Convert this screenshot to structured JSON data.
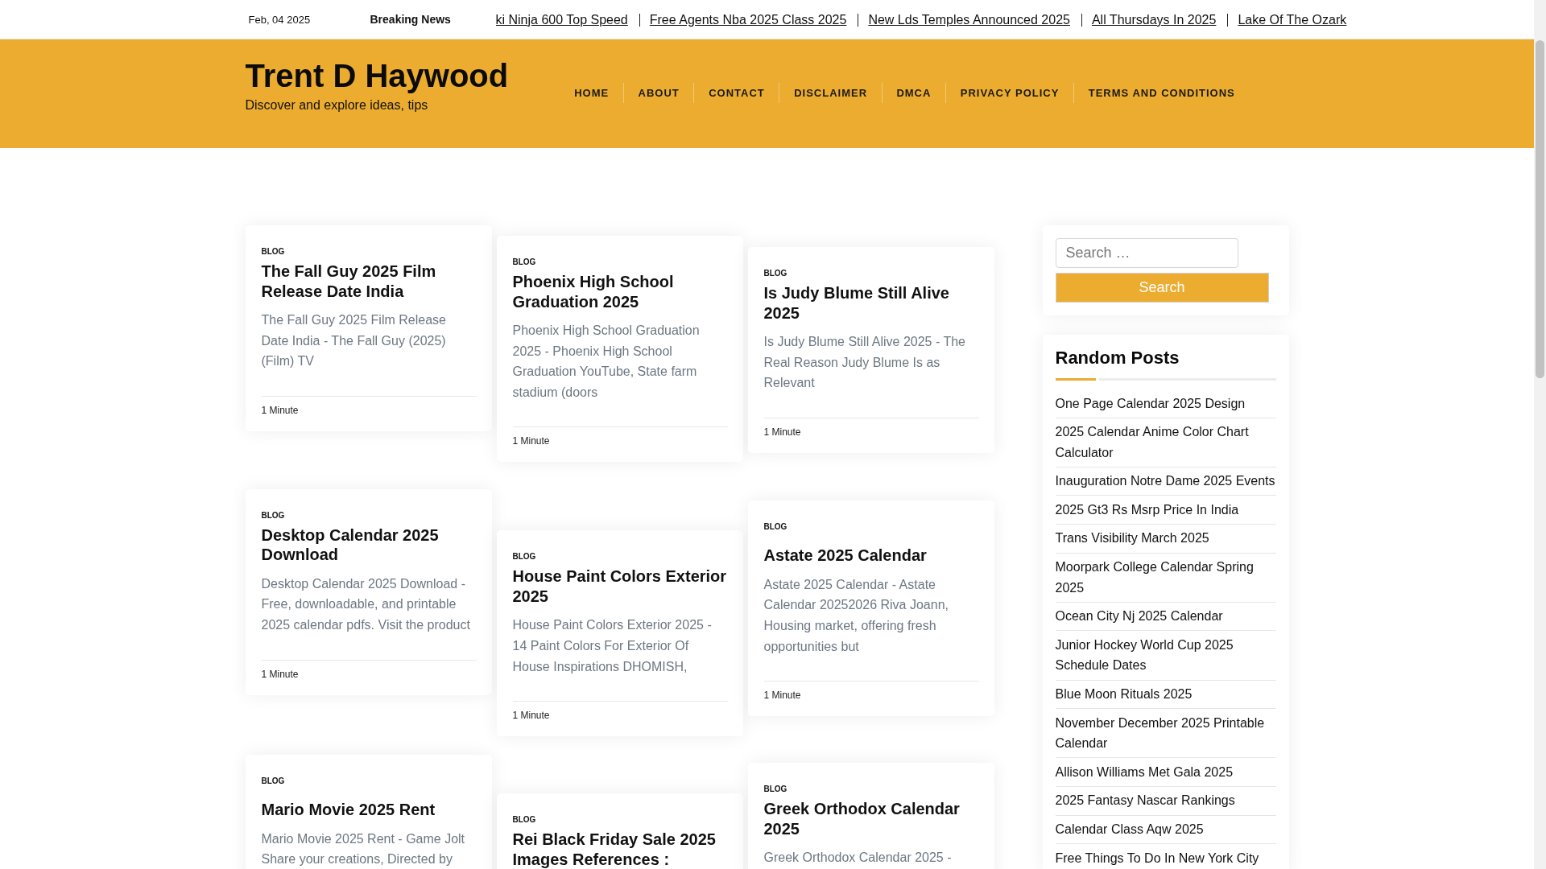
{
  "top_bar": {
    "date": "Feb, 04 2025",
    "breaking_label": "Breaking News",
    "ticker": [
      "ki Ninja 600 Top Speed",
      "Free Agents Nba 2025 Class 2025",
      "New Lds Temples Announced 2025",
      "All Thursdays In 2025",
      "Lake Of The Ozark"
    ]
  },
  "header": {
    "site_title": "Trent D Haywood",
    "tagline": "Discover and explore ideas, tips",
    "nav": [
      "HOME",
      "ABOUT",
      "CONTACT",
      "DISCLAIMER",
      "DMCA",
      "PRIVACY POLICY",
      "TERMS AND CONDITIONS"
    ]
  },
  "posts": [
    {
      "category": "BLOG",
      "title": "The Fall Guy 2025 Film Release Date India",
      "excerpt": "The Fall Guy 2025 Film Release Date India - The Fall Guy (2025) (Film) TV",
      "read_time": "1 Minute"
    },
    {
      "category": "BLOG",
      "title": "Phoenix High School Graduation 2025",
      "excerpt": "Phoenix High School Graduation 2025 - Phoenix High School Graduation YouTube, State farm stadium (doors",
      "read_time": "1 Minute"
    },
    {
      "category": "BLOG",
      "title": "Is Judy Blume Still Alive 2025",
      "excerpt": "Is Judy Blume Still Alive 2025 - The Real Reason Judy Blume Is as Relevant",
      "read_time": "1 Minute"
    },
    {
      "category": "BLOG",
      "title": "Desktop Calendar 2025 Download",
      "excerpt": "Desktop Calendar 2025 Download - Free, downloadable, and printable 2025 calendar pdfs. Visit the product",
      "read_time": "1 Minute"
    },
    {
      "category": "BLOG",
      "title": "House Paint Colors Exterior 2025",
      "excerpt": "House Paint Colors Exterior 2025 - 14 Paint Colors For Exterior Of House Inspirations DHOMISH,",
      "read_time": "1 Minute"
    },
    {
      "category": "BLOG",
      "title": "Astate 2025 Calendar",
      "excerpt": "Astate 2025 Calendar - Astate Calendar 20252026 Riva Joann, Housing market, offering fresh opportunities but",
      "read_time": "1 Minute"
    },
    {
      "category": "BLOG",
      "title": "Mario Movie 2025 Rent",
      "excerpt": "Mario Movie 2025 Rent - Game Jolt Share your creations, Directed by"
    },
    {
      "category": "BLOG",
      "title": "Rei Black Friday Sale 2025 Images References :"
    },
    {
      "category": "BLOG",
      "title": "Greek Orthodox Calendar 2025",
      "excerpt": "Greek Orthodox Calendar 2025 -"
    }
  ],
  "sidebar": {
    "search": {
      "placeholder": "Search …",
      "button": "Search"
    },
    "random_posts": {
      "title": "Random Posts",
      "items": [
        "One Page Calendar 2025 Design",
        "2025 Calendar Anime Color Chart Calculator",
        "Inauguration Notre Dame 2025 Events",
        "2025 Gt3 Rs Msrp Price In India",
        "Trans Visibility March 2025",
        "Moorpark College Calendar Spring 2025",
        "Ocean City Nj 2025 Calendar",
        "Junior Hockey World Cup 2025 Schedule Dates",
        "Blue Moon Rituals 2025",
        "November December 2025 Printable Calendar",
        "Allison Williams Met Gala 2025",
        "2025 Fantasy Nascar Rankings",
        "Calendar Class Aqw 2025",
        "Free Things To Do In New York City"
      ]
    }
  }
}
